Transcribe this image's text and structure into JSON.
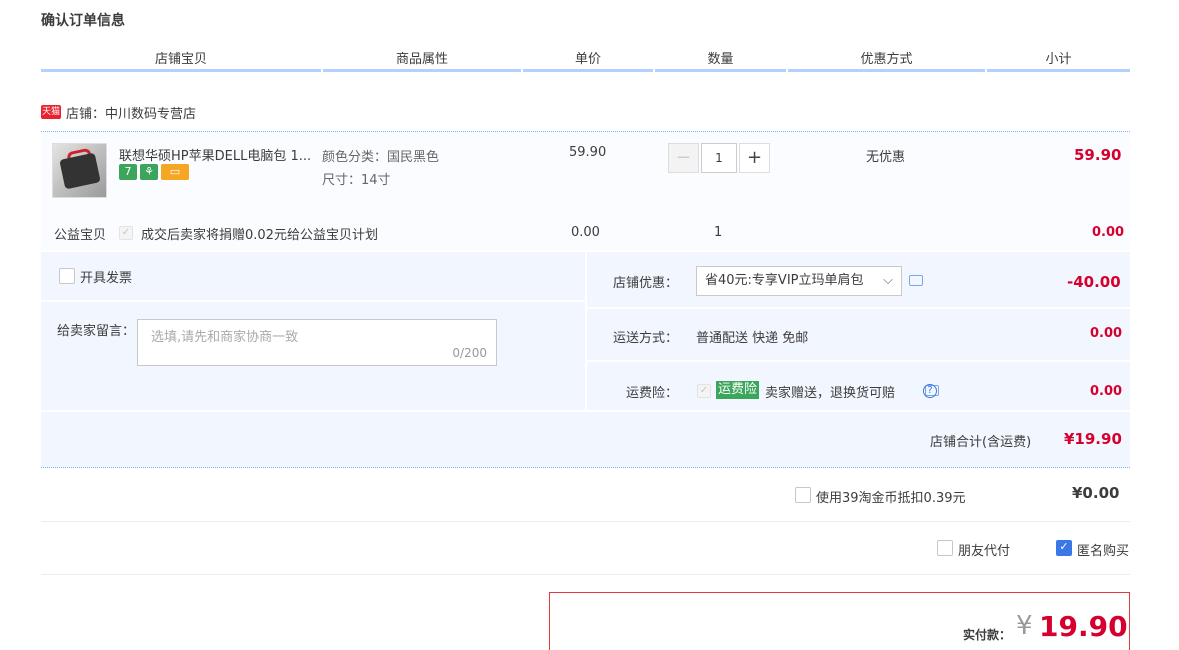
{
  "page_title": "确认订单信息",
  "table_headers": [
    "店铺宝贝",
    "商品属性",
    "单价",
    "数量",
    "优惠方式",
    "小计"
  ],
  "shop": {
    "icon_text": "天猫",
    "label": "店铺：中川数码专营店"
  },
  "item": {
    "name": "联想华硕HP苹果DELL电脑包 1...",
    "attr_color": "颜色分类：国民黑色",
    "attr_size": "尺寸：14寸",
    "unit_price": "59.90",
    "quantity": "1",
    "discount": "无优惠",
    "subtotal": "59.90",
    "badges": [
      {
        "icon": "seven-days-icon",
        "text": "7",
        "color": "#3ba55c"
      },
      {
        "icon": "gift-icon",
        "text": "⚘",
        "color": "#3ba55c"
      },
      {
        "icon": "card-icon",
        "text": "▭",
        "color": "#f5a623"
      }
    ]
  },
  "charity": {
    "label": "公益宝贝",
    "text": "成交后卖家将捐赠0.02元给公益宝贝计划",
    "price": "0.00",
    "quantity": "1",
    "subtotal": "0.00"
  },
  "invoice": {
    "label": "开具发票"
  },
  "memo": {
    "label": "给卖家留言：",
    "placeholder": "选填,请先和商家协商一致",
    "counter": "0/200"
  },
  "shop_discount": {
    "label": "店铺优惠：",
    "value": "省40元:专享VIP立玛单肩包",
    "amount": "-40.00"
  },
  "shipping": {
    "label": "运送方式：",
    "value": "普通配送 快递 免邮",
    "amount": "0.00"
  },
  "freight_insurance": {
    "label": "运费险：",
    "tag": "运费险",
    "text": "卖家赠送，退换货可赔",
    "amount": "0.00"
  },
  "shop_total": {
    "label": "店铺合计(含运费)",
    "amount": "¥19.90"
  },
  "taobao_coins": {
    "label": "使用39淘金币抵扣0.39元",
    "amount": "¥0.00"
  },
  "options": {
    "friend_pay": "朋友代付",
    "anonymous": "匿名购买"
  },
  "payment": {
    "label": "实付款：",
    "currency": "¥",
    "amount": "19.90"
  },
  "colors": {
    "accent_red": "#d5002e",
    "header_border": "#b2d1ff",
    "section_bg": "#f2f7ff",
    "checked_blue": "#3b78e7"
  }
}
